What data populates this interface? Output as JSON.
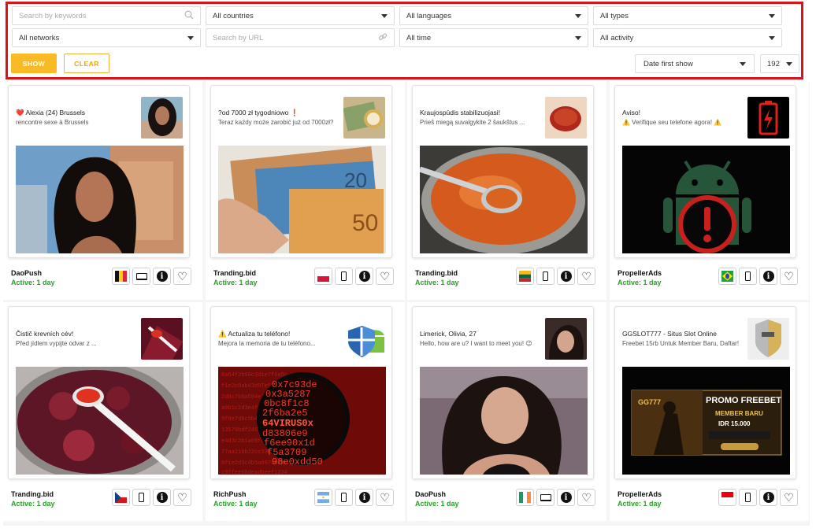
{
  "filters": {
    "search_keywords_placeholder": "Search by keywords",
    "countries": "All countries",
    "languages": "All languages",
    "types": "All types",
    "networks": "All networks",
    "search_url_placeholder": "Search by URL",
    "time": "All time",
    "activity": "All activity",
    "show_label": "SHOW",
    "clear_label": "CLEAR",
    "sort": "Date first show",
    "per_page": "192"
  },
  "cards": [
    {
      "title": "❤️ Alexia (24) Brussels",
      "text": "rencontre sexe à Brussels",
      "network": "DaoPush",
      "active": "Active: 1 day",
      "flag": "BE",
      "device": "desktop"
    },
    {
      "title": "?od 7000 zł tygodniowo ❗",
      "text": "Teraz każdy może zarobić już od 7000zł?",
      "network": "Tranding.bid",
      "active": "Active: 1 day",
      "flag": "PL",
      "device": "mobile"
    },
    {
      "title": "Kraujospūdis stabilizuojasi!",
      "text": "Prieš miegą suvalgykite 2 šaukštus ...",
      "network": "Tranding.bid",
      "active": "Active: 1 day",
      "flag": "LT",
      "device": "mobile"
    },
    {
      "title": "Aviso!",
      "text": "⚠️ Verifique seu telefone agora! ⚠️",
      "network": "PropellerAds",
      "active": "Active: 1 day",
      "flag": "BR",
      "device": "mobile"
    },
    {
      "title": "Čistič krevních cév!",
      "text": "Před jídlem vypijte odvar z ...",
      "network": "Tranding.bid",
      "active": "Active: 1 day",
      "flag": "CZ",
      "device": "mobile"
    },
    {
      "title": "⚠️ Actualiza tu teléfono!",
      "text": "Mejora la memoria de tu teléfono...",
      "network": "RichPush",
      "active": "Active: 1 day",
      "flag": "AR",
      "device": "mobile"
    },
    {
      "title": "Limerick, Olivia, 27",
      "text": "Hello, how are u? I want to meet you! 😉",
      "network": "DaoPush",
      "active": "Active: 1 day",
      "flag": "IE",
      "device": "desktop"
    },
    {
      "title": "GGSLOT777 - Situs Slot Online",
      "text": "Freebet 15rb Untuk Member Baru, Daftar!",
      "network": "PropellerAds",
      "active": "Active: 1 day",
      "flag": "ID",
      "device": "mobile"
    }
  ],
  "banner_text": {
    "promo_title": "PROMO FREEBET",
    "member": "MEMBER BARU",
    "amount": "IDR 15.000",
    "brand": "GG777"
  },
  "matrix_text": [
    "0x7c93de",
    "0x3a5287",
    "0bc8f1c8",
    "2f6ba2e5",
    "64VIRUS0x",
    "d83806e9",
    "f6ee90x1d",
    "f5a3709",
    "98e0xdd50"
  ],
  "colors": {
    "accent_yellow": "#f9bb25",
    "active_green": "#27a227",
    "panel_border": "#d9131a"
  }
}
